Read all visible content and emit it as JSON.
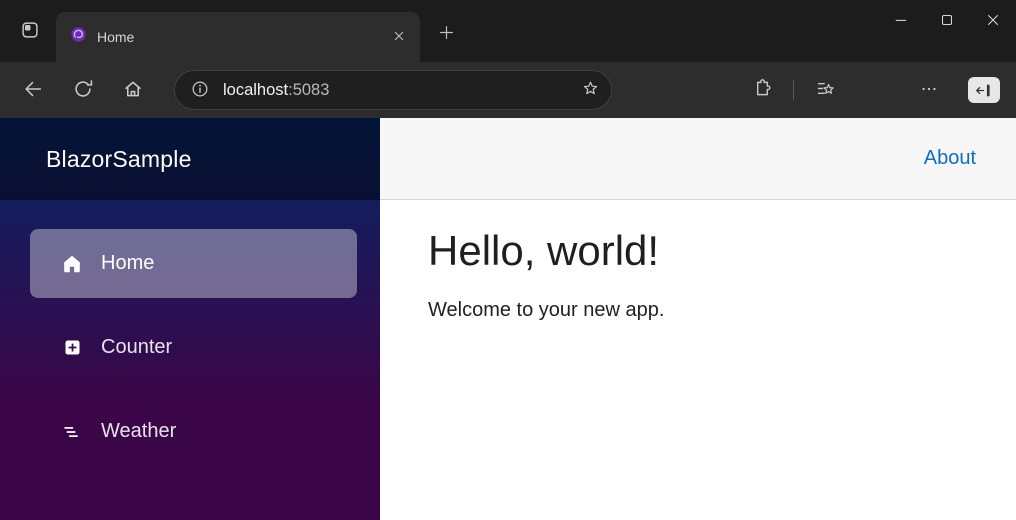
{
  "browser": {
    "tab": {
      "title": "Home"
    },
    "address": {
      "host": "localhost",
      "port": ":5083"
    },
    "icons": {
      "tab_actions": "workspaces-icon",
      "tab_favicon": "blazor-logo-icon",
      "tab_close": "close-icon",
      "new_tab": "plus-icon",
      "minimize": "minimize-icon",
      "maximize": "maximize-icon",
      "window_close": "close-icon",
      "back": "arrow-left-icon",
      "refresh": "refresh-icon",
      "home": "home-icon",
      "site_info": "info-icon",
      "favorite_star": "star-icon",
      "extensions": "puzzle-icon",
      "favorites_hub": "star-lines-icon",
      "more": "ellipsis-icon",
      "sidebar_toggle": "split-screen-icon"
    }
  },
  "app": {
    "brand": "BlazorSample",
    "nav": [
      {
        "label": "Home",
        "icon": "house-icon",
        "active": true
      },
      {
        "label": "Counter",
        "icon": "plus-square-icon",
        "active": false
      },
      {
        "label": "Weather",
        "icon": "list-nested-icon",
        "active": false
      }
    ],
    "header": {
      "about_label": "About"
    },
    "main": {
      "heading": "Hello, world!",
      "welcome": "Welcome to your new app."
    }
  },
  "colors": {
    "link_blue": "#0a6fc2",
    "sidebar_gradient_top": "#052767",
    "sidebar_gradient_bottom": "#3a0647",
    "active_nav_bg": "rgba(255,255,255,0.37)",
    "topbar_bg": "#f7f7f7",
    "chrome_dark": "#1c1c1c",
    "chrome_mid": "#2d2d2d"
  }
}
